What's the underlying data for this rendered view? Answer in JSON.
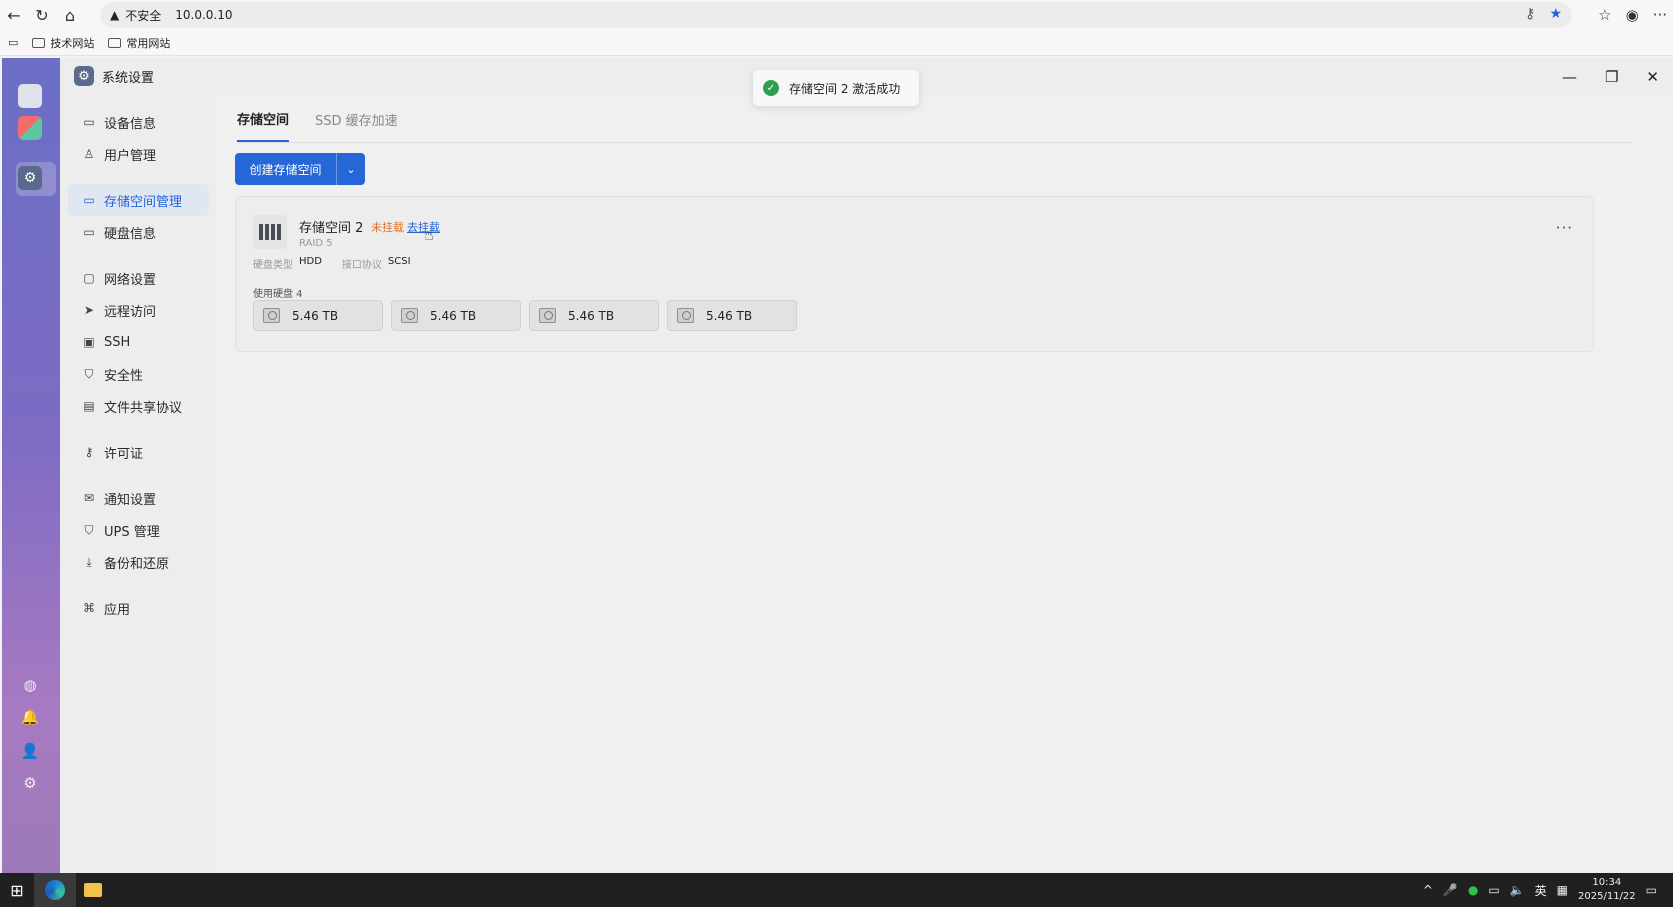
{
  "browser": {
    "security_label": "不安全",
    "url": "10.0.0.10",
    "bookmarks": [
      {
        "label": "技术网站"
      },
      {
        "label": "常用网站"
      }
    ]
  },
  "window": {
    "title": "系统设置"
  },
  "sidebar": {
    "items": [
      {
        "label": "设备信息",
        "icon": "device-icon"
      },
      {
        "label": "用户管理",
        "icon": "users-icon"
      },
      {
        "label": "存储空间管理",
        "icon": "storage-icon",
        "active": true
      },
      {
        "label": "硬盘信息",
        "icon": "disk-icon"
      },
      {
        "label": "网络设置",
        "icon": "network-icon"
      },
      {
        "label": "远程访问",
        "icon": "send-icon"
      },
      {
        "label": "SSH",
        "icon": "terminal-icon"
      },
      {
        "label": "安全性",
        "icon": "shield-icon"
      },
      {
        "label": "文件共享协议",
        "icon": "file-icon"
      },
      {
        "label": "许可证",
        "icon": "key-icon"
      },
      {
        "label": "通知设置",
        "icon": "mail-icon"
      },
      {
        "label": "UPS 管理",
        "icon": "ups-icon"
      },
      {
        "label": "备份和还原",
        "icon": "backup-icon"
      },
      {
        "label": "应用",
        "icon": "apps-icon"
      }
    ]
  },
  "tabs": [
    {
      "label": "存储空间",
      "active": true
    },
    {
      "label": "SSD 缓存加速",
      "active": false
    }
  ],
  "create_button": {
    "label": "创建存储空间"
  },
  "pool": {
    "name": "存储空间 2",
    "status": "未挂载",
    "mount_link": "去挂载",
    "raid": "RAID 5",
    "disk_type_label": "硬盘类型",
    "disk_type": "HDD",
    "interface_label": "接口协议",
    "interface": "SCSI",
    "disks_label": "使用硬盘 4",
    "disks": [
      {
        "size": "5.46 TB"
      },
      {
        "size": "5.46 TB"
      },
      {
        "size": "5.46 TB"
      },
      {
        "size": "5.46 TB"
      }
    ]
  },
  "toast": {
    "message": "存储空间 2 激活成功"
  },
  "taskbar": {
    "ime": "英",
    "time": "10:34",
    "date": "2025/11/22"
  },
  "colors": {
    "accent": "#2567d6",
    "warning": "#e0702b",
    "success": "#2f9e51"
  }
}
